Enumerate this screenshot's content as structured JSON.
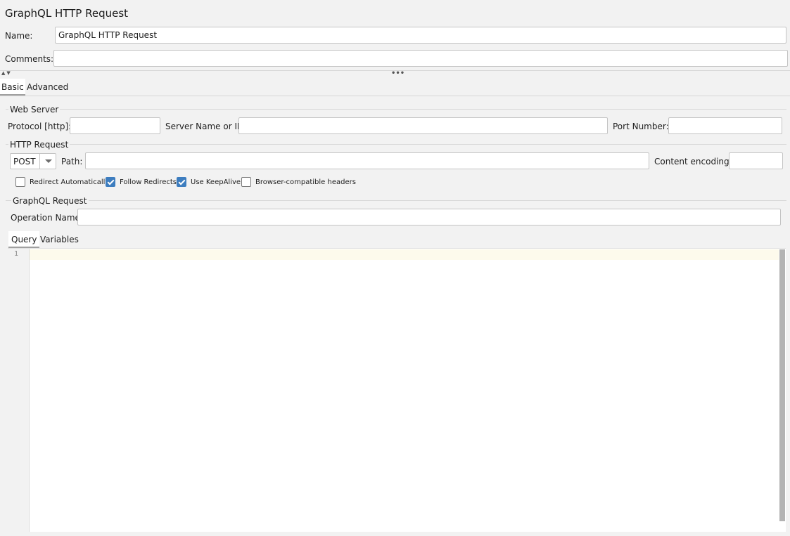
{
  "window": {
    "title": "GraphQL HTTP Request"
  },
  "name_row": {
    "label": "Name:",
    "value": "GraphQL HTTP Request"
  },
  "comments_row": {
    "label": "Comments:",
    "value": ""
  },
  "splitter": {
    "collapse_icon": "▲▼",
    "grip_icon": "•••"
  },
  "tabs": {
    "basic": "Basic",
    "advanced": "Advanced",
    "selected": "Basic"
  },
  "web_server": {
    "group_title": "Web Server",
    "protocol_label": "Protocol [http]:",
    "protocol_value": "",
    "server_label": "Server Name or IP:",
    "server_value": "",
    "port_label": "Port Number:",
    "port_value": ""
  },
  "http_request": {
    "group_title": "HTTP Request",
    "method": "POST",
    "path_label": "Path:",
    "path_value": "",
    "encoding_label": "Content encoding:",
    "encoding_value": "",
    "options": [
      {
        "label": "Redirect Automatically",
        "checked": false
      },
      {
        "label": "Follow Redirects",
        "checked": true
      },
      {
        "label": "Use KeepAlive",
        "checked": true
      },
      {
        "label": "Browser-compatible headers",
        "checked": false
      }
    ]
  },
  "graphql_request": {
    "group_title": "GraphQL Request",
    "operation_label": "Operation Name",
    "operation_value": "",
    "tabs": {
      "query": "Query",
      "variables": "Variables",
      "selected": "Query"
    },
    "editor": {
      "line_numbers": [
        "1"
      ],
      "content": ""
    }
  },
  "colors": {
    "checkbox_checked": "#3d7dbf",
    "current_line": "#fdfaec",
    "background": "#f2f2f2"
  }
}
